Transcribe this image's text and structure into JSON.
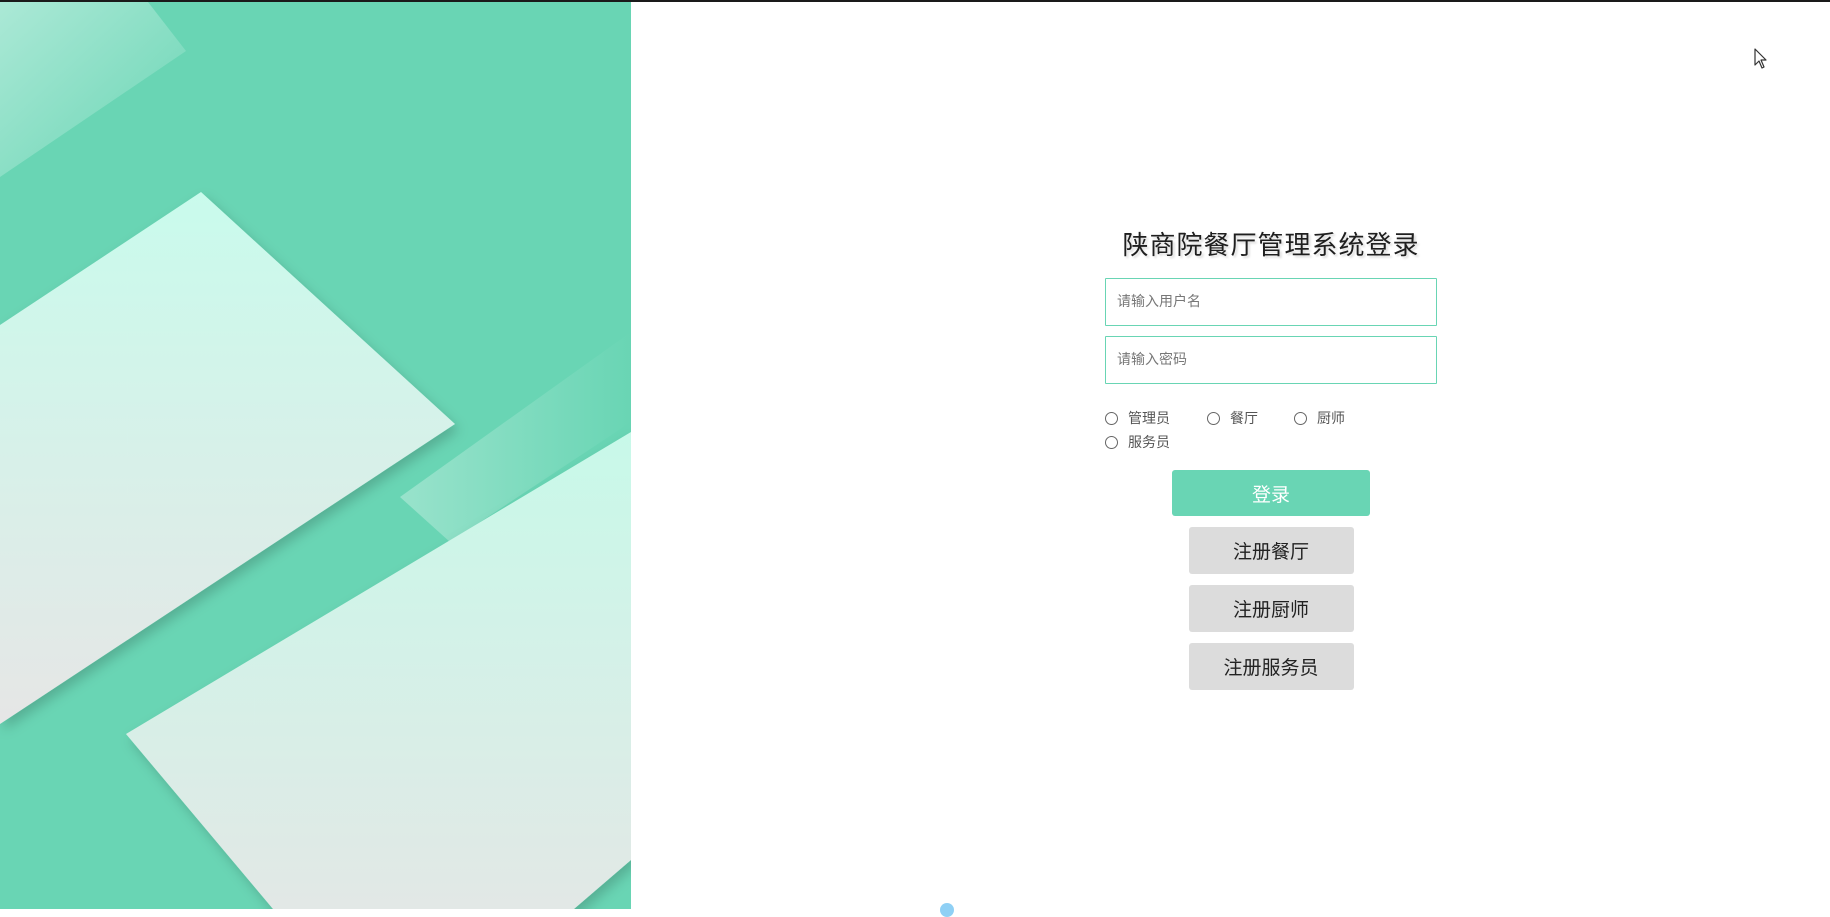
{
  "login": {
    "title": "陕商院餐厅管理系统登录",
    "username_placeholder": "请输入用户名",
    "password_placeholder": "请输入密码",
    "roles": [
      "管理员",
      "餐厅",
      "厨师",
      "服务员"
    ],
    "login_button": "登录",
    "register_buttons": [
      "注册餐厅",
      "注册厨师",
      "注册服务员"
    ]
  },
  "colors": {
    "accent": "#69d5b4",
    "secondary_button": "#dcdcdc"
  }
}
